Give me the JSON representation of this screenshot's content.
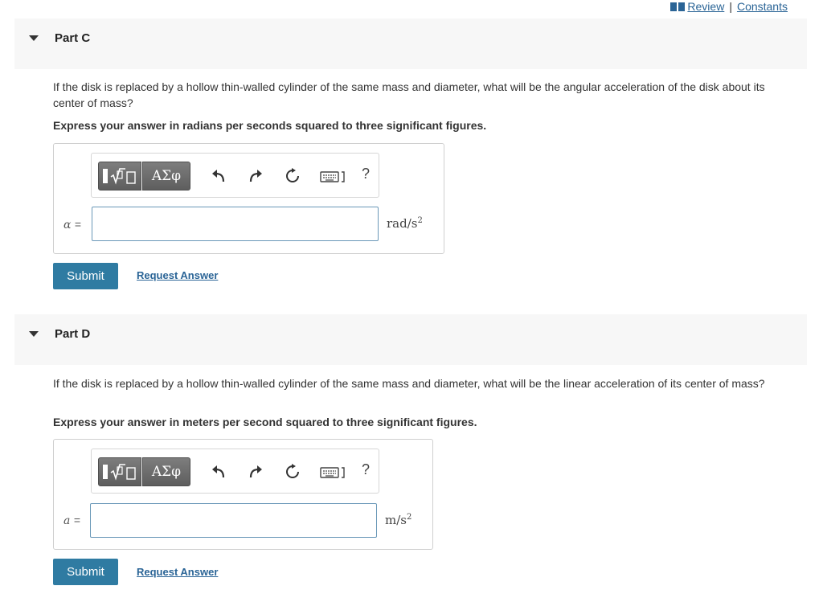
{
  "top_links": {
    "review": "Review",
    "separator": "|",
    "constants": "Constants",
    "icon": "book-icon"
  },
  "parts": [
    {
      "title": "Part C",
      "question": "If the disk is replaced by a hollow thin-walled cylinder of the same mass and diameter, what will be the angular acceleration of the disk about its center of mass?",
      "instruction": "Express your answer in radians per seconds squared to three significant figures.",
      "toolbar": {
        "symbols_label": "ΑΣφ",
        "help_label": "?"
      },
      "variable": "α",
      "equals": "=",
      "input_value": "",
      "unit_base": "rad/s",
      "unit_exp": "2",
      "submit_label": "Submit",
      "request_label": "Request Answer"
    },
    {
      "title": "Part D",
      "question": "If the disk is replaced by a hollow thin-walled cylinder of the same mass and diameter, what will be the linear acceleration of its center of mass?",
      "instruction": "Express your answer in meters per second squared to three significant figures.",
      "toolbar": {
        "symbols_label": "ΑΣφ",
        "help_label": "?"
      },
      "variable": "a",
      "equals": "=",
      "input_value": "",
      "unit_base": "m/s",
      "unit_exp": "2",
      "submit_label": "Submit",
      "request_label": "Request Answer"
    }
  ],
  "colors": {
    "accent": "#2f7ba2",
    "link": "#2a6496",
    "header_bg": "#f7f7f7",
    "toolbar_button": "#6e6e6e"
  }
}
